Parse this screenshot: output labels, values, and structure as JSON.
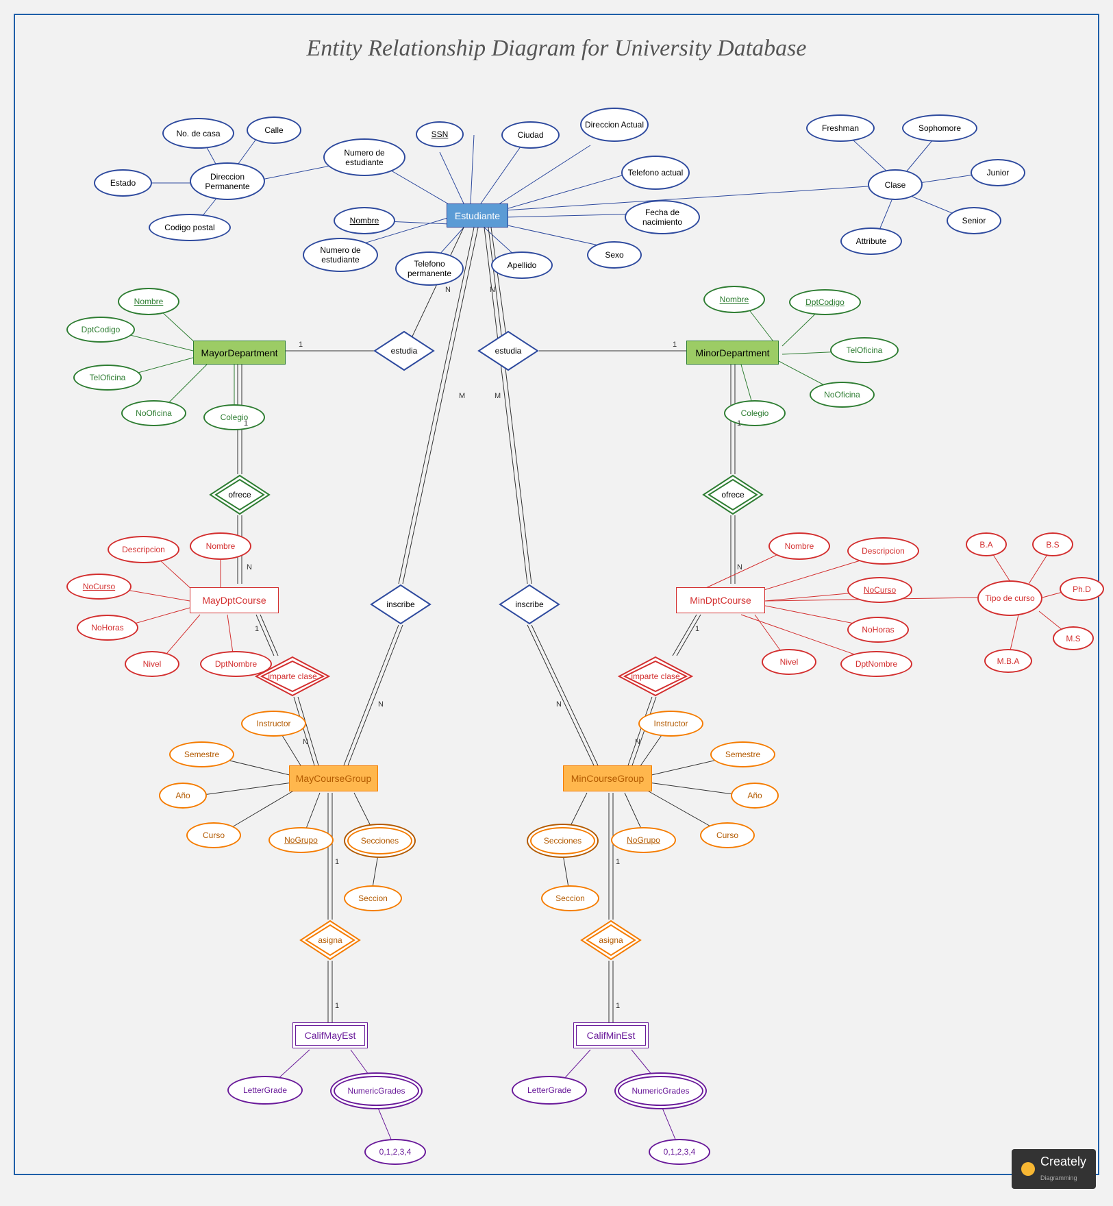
{
  "title": "Entity Relationship Diagram for University Database",
  "colors": {
    "blue": {
      "stroke": "#1f3a93",
      "fill": "#5b9bd5",
      "text": "#fff"
    },
    "navy": {
      "stroke": "#2e4a9e"
    },
    "green": {
      "stroke": "#2e7d32",
      "fill": "#9ccc65",
      "text": "#333"
    },
    "red": {
      "stroke": "#d32f2f",
      "fill": "#fff",
      "text": "#d32f2f"
    },
    "orange": {
      "stroke": "#f57c00",
      "fill": "#ffb74d",
      "text": "#b35a00"
    },
    "purple": {
      "stroke": "#6a1b9a",
      "fill": "#fff",
      "text": "#6a1b9a"
    }
  },
  "entities": {
    "estudiante": "Estudiante",
    "mayorDept": "MayorDepartment",
    "minorDept": "MinorDepartment",
    "mayDptCourse": "MayDptCourse",
    "minDptCourse": "MinDptCourse",
    "mayCourseGroup": "MayCourseGroup",
    "minCourseGroup": "MinCourseGroup",
    "califMayEst": "CalifMayEst",
    "califMinEst": "CalifMinEst"
  },
  "relationships": {
    "estudia1": "estudia",
    "estudia2": "estudia",
    "ofrece1": "ofrece",
    "ofrece2": "ofrece",
    "inscribe1": "inscribe",
    "inscribe2": "inscribe",
    "imparte1": "imparte clase",
    "imparte2": "imparte clase",
    "asigna1": "asigna",
    "asigna2": "asigna"
  },
  "attributes": {
    "estudiante": {
      "ssn": "SSN",
      "ciudad": "Ciudad",
      "dirActual": "Direccion Actual",
      "telActual": "Telefono actual",
      "fechaNac": "Fecha de nacimiento",
      "sexo": "Sexo",
      "apellido": "Apellido",
      "nombre": "Nombre",
      "telPerm": "Telefono permanente",
      "numEst": "Numero de estudiante",
      "dirPerm": "Direccion Permanente",
      "noCasa": "No. de casa",
      "calle": "Calle",
      "estado": "Estado",
      "codPostal": "Codigo postal",
      "clase": "Clase",
      "freshman": "Freshman",
      "sophomore": "Sophomore",
      "junior": "Junior",
      "senior": "Senior",
      "attribute": "Attribute"
    },
    "mayorDept": {
      "nombre": "Nombre",
      "dptCodigo": "DptCodigo",
      "telOficina": "TelOficina",
      "noOficina": "NoOficina",
      "colegio": "Colegio"
    },
    "minorDept": {
      "nombre": "Nombre",
      "dptCodigo": "DptCodigo",
      "telOficina": "TelOficina",
      "noOficina": "NoOficina",
      "colegio": "Colegio"
    },
    "mayDptCourse": {
      "descripcion": "Descripcion",
      "nombre": "Nombre",
      "noCurso": "NoCurso",
      "noHoras": "NoHoras",
      "nivel": "Nivel",
      "dptNombre": "DptNombre"
    },
    "minDptCourse": {
      "nombre": "Nombre",
      "descripcion": "Descripcion",
      "noCurso": "NoCurso",
      "noHoras": "NoHoras",
      "nivel": "Nivel",
      "dptNombre": "DptNombre",
      "tipoCurso": "Tipo de curso",
      "ba": "B.A",
      "bs": "B.S",
      "phd": "Ph.D",
      "ms": "M.S",
      "mba": "M.B.A"
    },
    "mayCourseGroup": {
      "instructor": "Instructor",
      "semestre": "Semestre",
      "ano": "Año",
      "curso": "Curso",
      "noGrupo": "NoGrupo",
      "secciones": "Secciones",
      "seccion": "Seccion"
    },
    "minCourseGroup": {
      "instructor": "Instructor",
      "semestre": "Semestre",
      "ano": "Año",
      "curso": "Curso",
      "noGrupo": "NoGrupo",
      "secciones": "Secciones",
      "seccion": "Seccion"
    },
    "califMayEst": {
      "letterGrade": "LetterGrade",
      "numericGrades": "NumericGrades",
      "vals": "0,1,2,3,4"
    },
    "califMinEst": {
      "letterGrade": "LetterGrade",
      "numericGrades": "NumericGrades",
      "vals": "0,1,2,3,4"
    }
  },
  "cardinalities": {
    "one": "1",
    "many": "N",
    "m": "M"
  },
  "logo": {
    "brand": "Creately",
    "tagline": "Diagramming"
  }
}
